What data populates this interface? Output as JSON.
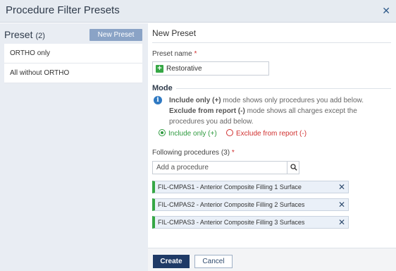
{
  "dialog": {
    "title": "Procedure Filter Presets",
    "close_icon": "close-icon"
  },
  "sidebar": {
    "header": "Preset",
    "count": "(2)",
    "new_button": "New Preset",
    "items": [
      {
        "label": "ORTHO only"
      },
      {
        "label": "All without ORTHO"
      }
    ]
  },
  "form": {
    "heading": "New Preset",
    "preset_name_label": "Preset name",
    "required_mark": "*",
    "preset_name_value": "Restorative",
    "mode": {
      "title": "Mode",
      "info_include_strong": "Include only (+)",
      "info_include_rest": " mode shows only procedures you add below.",
      "info_exclude_strong": "Exclude from report (-)",
      "info_exclude_rest": " mode shows all charges except the procedures you add below.",
      "option_include": "Include only (+)",
      "option_exclude": "Exclude from report (-)",
      "selected": "Include only (+)"
    },
    "procedures_label": "Following procedures (3)",
    "search_placeholder": "Add a procedure",
    "procedures": [
      {
        "label": "FIL-CMPAS1 - Anterior Composite Filling 1 Surface"
      },
      {
        "label": "FIL-CMPAS2 - Anterior Composite Filling 2 Surfaces"
      },
      {
        "label": "FIL-CMPAS3 - Anterior Composite Filling 3 Surfaces"
      }
    ]
  },
  "footer": {
    "create_label": "Create",
    "cancel_label": "Cancel"
  },
  "colors": {
    "accent_green": "#36a745",
    "exclude_red": "#d0302f",
    "primary_navy": "#1f3a66"
  }
}
